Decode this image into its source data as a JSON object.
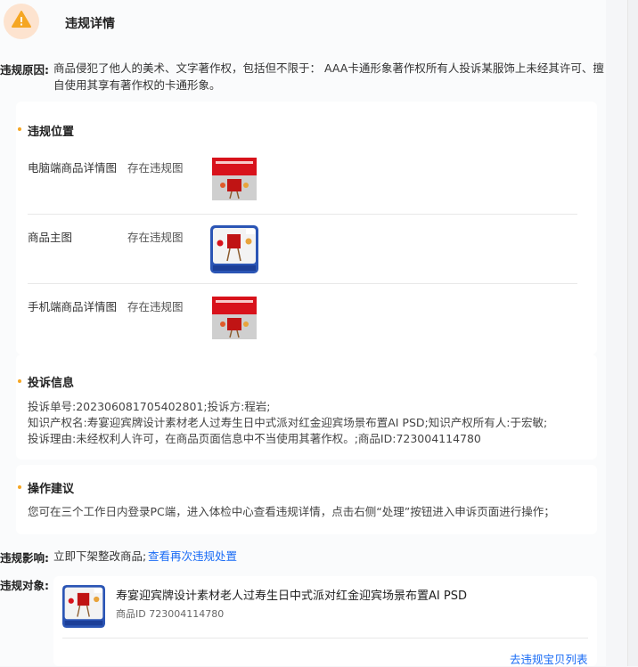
{
  "header": {
    "title": "违规详情",
    "icon": "warning-icon"
  },
  "reason": {
    "label": "违规原因:",
    "line1": "商品侵犯了他人的美术、文字著作权，包括但不限于： AAA卡通形象著作权所有人投诉某服饰上未经其许可、擅",
    "line2": "自使用其享有著作权的卡通形象。"
  },
  "location": {
    "title": "违规位置",
    "items": [
      {
        "name": "电脑端商品详情图",
        "status": "存在违规图"
      },
      {
        "name": "商品主图",
        "status": "存在违规图"
      },
      {
        "name": "手机端商品详情图",
        "status": "存在违规图"
      }
    ]
  },
  "complaint": {
    "title": "投诉信息",
    "lines": [
      "投诉单号:202306081705402801;投诉方:程岩;",
      "知识产权名:寿宴迎宾牌设计素材老人过寿生日中式派对红金迎宾场景布置AI PSD;知识产权所有人:于宏敏;",
      "投诉理由:未经权利人许可，在商品页面信息中不当使用其著作权。;商品ID:723004114780"
    ]
  },
  "advice": {
    "title": "操作建议",
    "text": "您可在三个工作日内登录PC端，进入体检中心查看违规详情，点击右侧“处理”按钮进入申诉页面进行操作；"
  },
  "impact": {
    "label": "违规影响:",
    "text": "立即下架整改商品;",
    "link": "查看再次违规处置"
  },
  "target": {
    "label": "违规对象:",
    "product_title": "寿宴迎宾牌设计素材老人过寿生日中式派对红金迎宾场景布置AI PSD",
    "product_id": "商品ID 723004114780",
    "list_link": "去违规宝贝列表"
  },
  "colors": {
    "accent": "#f5a623",
    "link": "#1a6cf5",
    "poster_red": "#d8121b",
    "blue_frame": "#2b55b5"
  }
}
